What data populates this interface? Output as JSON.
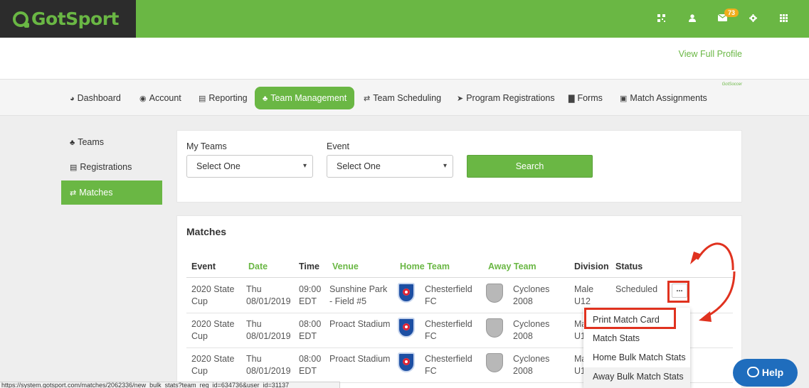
{
  "brand": {
    "name": "GotSport",
    "accent": "#6ab744",
    "dark": "#2c2c2c",
    "highlight": "#e0321f"
  },
  "topbar": {
    "mail_count": "73",
    "icons": [
      "qr-code-icon",
      "user-icon",
      "mail-icon",
      "gear-icon",
      "apps-grid-icon"
    ]
  },
  "profile": {
    "link": "View Full Profile",
    "mini_logo": "GotSoccer"
  },
  "nav": {
    "items": [
      {
        "label": "Dashboard",
        "icon": "dashboard-icon"
      },
      {
        "label": "Account",
        "icon": "account-icon"
      },
      {
        "label": "Reporting",
        "icon": "reporting-icon"
      },
      {
        "label": "Team Management",
        "icon": "team-icon",
        "active": true
      },
      {
        "label": "Team Scheduling",
        "icon": "exchange-icon"
      },
      {
        "label": "Program Registrations",
        "icon": "send-icon"
      },
      {
        "label": "Forms",
        "icon": "file-icon"
      },
      {
        "label": "Match Assignments",
        "icon": "calendar-icon"
      }
    ]
  },
  "sidebar": {
    "items": [
      {
        "label": "Teams",
        "icon": "users-icon"
      },
      {
        "label": "Registrations",
        "icon": "list-icon"
      },
      {
        "label": "Matches",
        "icon": "exchange-icon",
        "active": true
      }
    ]
  },
  "filters": {
    "my_teams_label": "My Teams",
    "my_teams_value": "Select One",
    "event_label": "Event",
    "event_value": "Select One",
    "search_label": "Search"
  },
  "matches": {
    "title": "Matches",
    "columns": [
      "Event",
      "Date",
      "Time",
      "Venue",
      "Home Team",
      "Away Team",
      "Division",
      "Status"
    ],
    "rows": [
      {
        "event": [
          "2020 State",
          "Cup"
        ],
        "date": [
          "Thu",
          "08/01/2019"
        ],
        "time": [
          "09:00",
          "EDT"
        ],
        "venue": [
          "Sunshine Park",
          "- Field #5"
        ],
        "home": [
          "Chesterfield",
          "FC"
        ],
        "away": [
          "Cyclones",
          "2008"
        ],
        "division": [
          "Male",
          "U12"
        ],
        "status": "Scheduled"
      },
      {
        "event": [
          "2020 State",
          "Cup"
        ],
        "date": [
          "Thu",
          "08/01/2019"
        ],
        "time": [
          "08:00",
          "EDT"
        ],
        "venue": [
          "Proact Stadium",
          ""
        ],
        "home": [
          "Chesterfield",
          "FC"
        ],
        "away": [
          "Cyclones",
          "2008"
        ],
        "division": [
          "Ma",
          "U1"
        ],
        "status": ""
      },
      {
        "event": [
          "2020 State",
          "Cup"
        ],
        "date": [
          "Thu",
          "08/01/2019"
        ],
        "time": [
          "08:00",
          "EDT"
        ],
        "venue": [
          "Proact Stadium",
          ""
        ],
        "home": [
          "Chesterfield",
          "FC"
        ],
        "away": [
          "Cyclones",
          "2008"
        ],
        "division": [
          "Ma",
          "U1"
        ],
        "status": ""
      }
    ],
    "more_label": "..."
  },
  "dropdown": {
    "items": [
      "Print Match Card",
      "Match Stats",
      "Home Bulk Match Stats",
      "Away Bulk Match Stats"
    ]
  },
  "status_url": "https://system.gotsport.com/matches/2062336/new_bulk_stats?team_reg_id=634736&user_id=31137",
  "help": {
    "label": "Help"
  }
}
